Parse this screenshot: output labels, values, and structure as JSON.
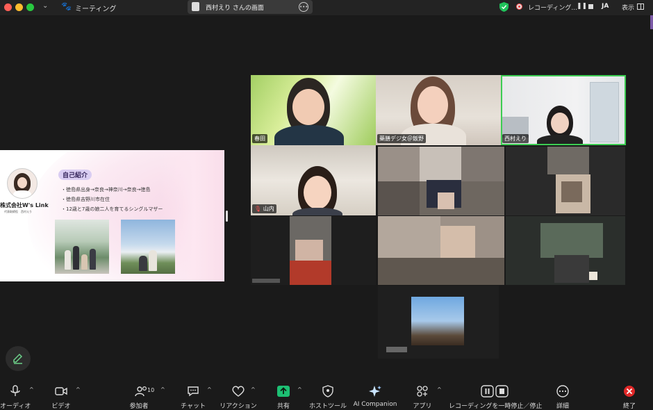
{
  "titlebar": {
    "app_title": "ミーティング",
    "screen_share_label": "西村えり さんの画面",
    "recording_label": "レコーディング...",
    "language": "JA",
    "view_label": "表示"
  },
  "slide": {
    "company": "株式会社W's Link",
    "representative": "代表取締役　西村えり",
    "heading": "自己紹介",
    "bullets": [
      "・徳島県出身→奈良→神奈川→奈良→徳島",
      "・徳島県吉野川市在住",
      "・12歳と7歳の娘二人を育てるシングルマザー"
    ]
  },
  "participants": [
    {
      "name": "春田"
    },
    {
      "name": "藥膳デジ女＠飯野"
    },
    {
      "name": "西村えり"
    },
    {
      "name": "山内"
    }
  ],
  "toolbar": {
    "audio": "オーディオ",
    "video": "ビデオ",
    "participants": "参加者",
    "participant_count": "10",
    "chat": "チャット",
    "reactions": "リアクション",
    "share": "共有",
    "host_tools": "ホストツール",
    "ai_companion": "AI Companion",
    "apps": "アプリ",
    "recording_controls": "レコーディングを一時停止／停止",
    "more": "詳細",
    "end": "終了"
  },
  "colors": {
    "active_speaker_border": "#3ccc52",
    "share_green": "#1dbf73",
    "end_red": "#e02828",
    "badge_purple": "#d9cdf2"
  }
}
